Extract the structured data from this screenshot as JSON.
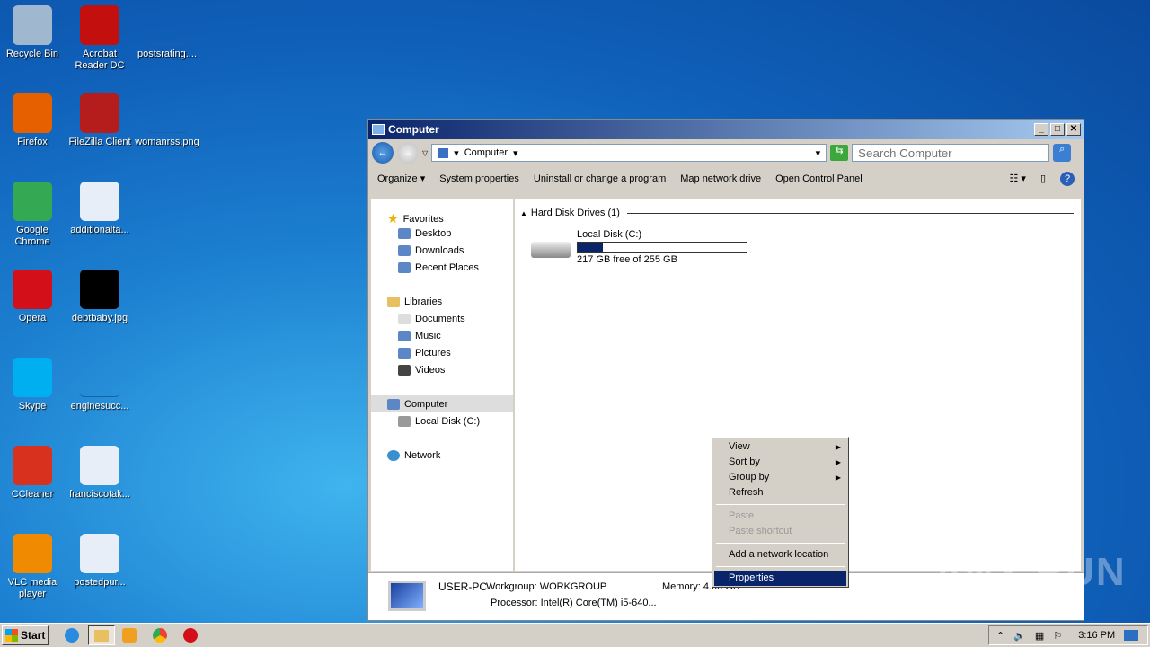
{
  "desktop": {
    "icons": [
      {
        "label": "Recycle Bin",
        "color": "#9fb8d0"
      },
      {
        "label": "Acrobat Reader DC",
        "color": "#c40f0f"
      },
      {
        "label": "postsrating....",
        "color": "file"
      },
      {
        "label": "Firefox",
        "color": "#e66000"
      },
      {
        "label": "FileZilla Client",
        "color": "#b51d1d"
      },
      {
        "label": "womanrss.png",
        "color": "file"
      },
      {
        "label": "Google Chrome",
        "color": "#34a853"
      },
      {
        "label": "additionalta...",
        "color": "#e8eef8"
      },
      {
        "label": "Opera",
        "color": "#d3101a"
      },
      {
        "label": "debtbaby.jpg",
        "color": "#000000"
      },
      {
        "label": "Skype",
        "color": "#00aff0"
      },
      {
        "label": "enginesucc...",
        "color": "file"
      },
      {
        "label": "CCleaner",
        "color": "#d8311d"
      },
      {
        "label": "franciscotak...",
        "color": "#e8eef8"
      },
      {
        "label": "VLC media player",
        "color": "#f08a00"
      },
      {
        "label": "postedpur...",
        "color": "#e8eef8"
      }
    ]
  },
  "window": {
    "title": "Computer",
    "address": "Computer",
    "search_placeholder": "Search Computer",
    "toolbar": [
      "Organize ▾",
      "System properties",
      "Uninstall or change a program",
      "Map network drive",
      "Open Control Panel"
    ],
    "nav": {
      "favorites": "Favorites",
      "desktop": "Desktop",
      "downloads": "Downloads",
      "recent": "Recent Places",
      "libraries": "Libraries",
      "documents": "Documents",
      "music": "Music",
      "pictures": "Pictures",
      "videos": "Videos",
      "computer": "Computer",
      "localdisk": "Local Disk (C:)",
      "network": "Network"
    },
    "group": "Hard Disk Drives (1)",
    "drive": {
      "name": "Local Disk (C:)",
      "free": "217 GB free of 255 GB",
      "used_fraction": 0.149
    },
    "details": {
      "name": "USER-PC",
      "workgroup": "Workgroup: WORKGROUP",
      "memory": "Memory: 4.00 GB",
      "processor": "Processor: Intel(R) Core(TM) i5-640..."
    }
  },
  "menu": {
    "view": "View",
    "sortby": "Sort by",
    "groupby": "Group by",
    "refresh": "Refresh",
    "paste": "Paste",
    "paste_shortcut": "Paste shortcut",
    "add_network": "Add a network location",
    "properties": "Properties"
  },
  "taskbar": {
    "start": "Start",
    "clock": "3:16 PM"
  },
  "watermark": "ANY RUN"
}
